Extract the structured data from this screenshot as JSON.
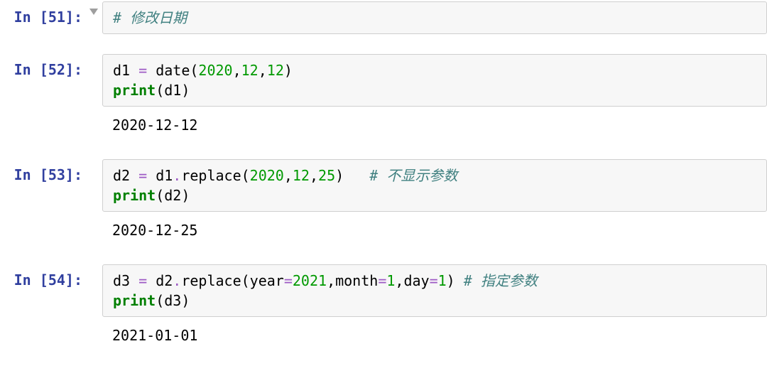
{
  "cells": [
    {
      "prompt_in": "In ",
      "prompt_num_open": "[",
      "prompt_num": "51",
      "prompt_num_close": "]:",
      "has_toggle": true,
      "code_tokens": [
        {
          "cls": "c-com",
          "t": "# 修改日期"
        }
      ],
      "output": null
    },
    {
      "prompt_in": "In ",
      "prompt_num_open": "[",
      "prompt_num": "52",
      "prompt_num_close": "]:",
      "has_toggle": false,
      "code_tokens": [
        {
          "cls": "c-txt",
          "t": "d1 "
        },
        {
          "cls": "c-op",
          "t": "="
        },
        {
          "cls": "c-txt",
          "t": " date("
        },
        {
          "cls": "c-num",
          "t": "2020"
        },
        {
          "cls": "c-txt",
          "t": ","
        },
        {
          "cls": "c-num",
          "t": "12"
        },
        {
          "cls": "c-txt",
          "t": ","
        },
        {
          "cls": "c-num",
          "t": "12"
        },
        {
          "cls": "c-txt",
          "t": ")\n"
        },
        {
          "cls": "c-builtin",
          "t": "print"
        },
        {
          "cls": "c-txt",
          "t": "(d1)"
        }
      ],
      "output": "2020-12-12"
    },
    {
      "prompt_in": "In ",
      "prompt_num_open": "[",
      "prompt_num": "53",
      "prompt_num_close": "]:",
      "has_toggle": false,
      "code_tokens": [
        {
          "cls": "c-txt",
          "t": "d2 "
        },
        {
          "cls": "c-op",
          "t": "="
        },
        {
          "cls": "c-txt",
          "t": " d1"
        },
        {
          "cls": "c-op",
          "t": "."
        },
        {
          "cls": "c-txt",
          "t": "replace("
        },
        {
          "cls": "c-num",
          "t": "2020"
        },
        {
          "cls": "c-txt",
          "t": ","
        },
        {
          "cls": "c-num",
          "t": "12"
        },
        {
          "cls": "c-txt",
          "t": ","
        },
        {
          "cls": "c-num",
          "t": "25"
        },
        {
          "cls": "c-txt",
          "t": ")   "
        },
        {
          "cls": "c-com",
          "t": "# 不显示参数"
        },
        {
          "cls": "c-txt",
          "t": "\n"
        },
        {
          "cls": "c-builtin",
          "t": "print"
        },
        {
          "cls": "c-txt",
          "t": "(d2)"
        }
      ],
      "output": "2020-12-25"
    },
    {
      "prompt_in": "In ",
      "prompt_num_open": "[",
      "prompt_num": "54",
      "prompt_num_close": "]:",
      "has_toggle": false,
      "code_tokens": [
        {
          "cls": "c-txt",
          "t": "d3 "
        },
        {
          "cls": "c-op",
          "t": "="
        },
        {
          "cls": "c-txt",
          "t": " d2"
        },
        {
          "cls": "c-op",
          "t": "."
        },
        {
          "cls": "c-txt",
          "t": "replace(year"
        },
        {
          "cls": "c-op",
          "t": "="
        },
        {
          "cls": "c-num",
          "t": "2021"
        },
        {
          "cls": "c-txt",
          "t": ",month"
        },
        {
          "cls": "c-op",
          "t": "="
        },
        {
          "cls": "c-num",
          "t": "1"
        },
        {
          "cls": "c-txt",
          "t": ",day"
        },
        {
          "cls": "c-op",
          "t": "="
        },
        {
          "cls": "c-num",
          "t": "1"
        },
        {
          "cls": "c-txt",
          "t": ") "
        },
        {
          "cls": "c-com",
          "t": "# 指定参数"
        },
        {
          "cls": "c-txt",
          "t": "\n"
        },
        {
          "cls": "c-builtin",
          "t": "print"
        },
        {
          "cls": "c-txt",
          "t": "(d3)"
        }
      ],
      "output": "2021-01-01"
    }
  ]
}
